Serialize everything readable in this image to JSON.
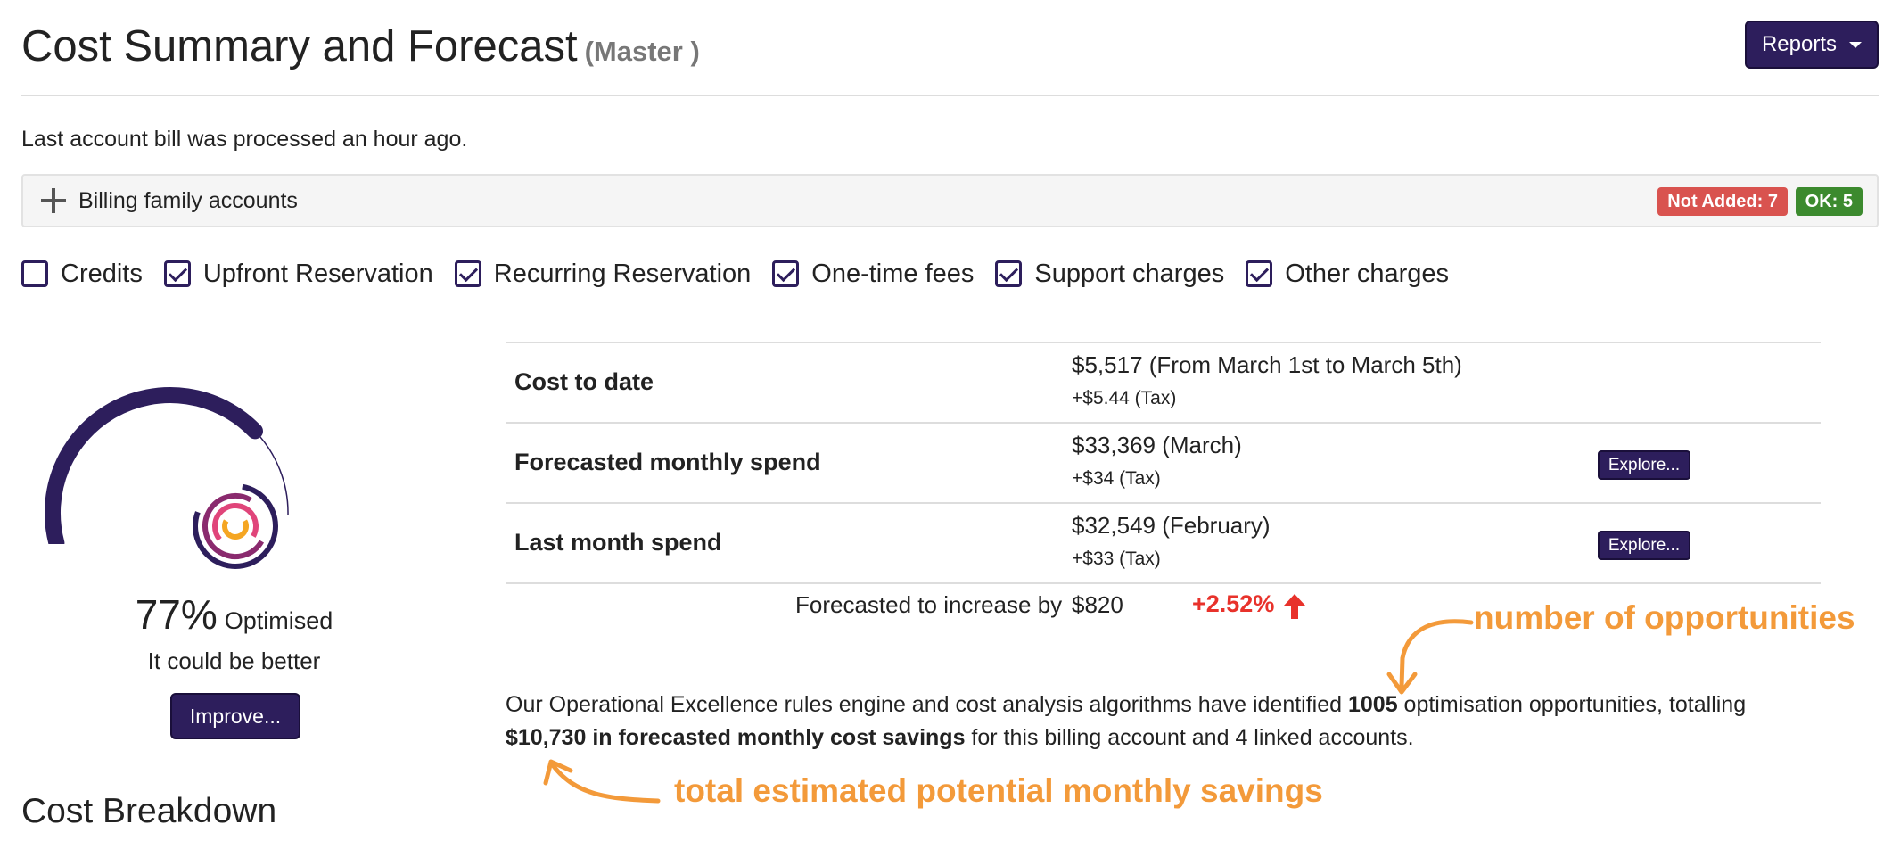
{
  "header": {
    "title": "Cost Summary and Forecast",
    "subtitle": "(Master )",
    "reports_label": "Reports"
  },
  "status": {
    "last_bill": "Last account bill was processed an hour ago."
  },
  "billing_family": {
    "label": "Billing family accounts",
    "not_added": "Not Added: 7",
    "ok": "OK: 5"
  },
  "filters": [
    {
      "label": "Credits",
      "checked": false
    },
    {
      "label": "Upfront Reservation",
      "checked": true
    },
    {
      "label": "Recurring Reservation",
      "checked": true
    },
    {
      "label": "One-time fees",
      "checked": true
    },
    {
      "label": "Support charges",
      "checked": true
    },
    {
      "label": "Other charges",
      "checked": true
    }
  ],
  "gauge": {
    "percent": 77,
    "percent_text": "77%",
    "word": "Optimised",
    "message": "It could be better",
    "improve_label": "Improve...",
    "color": "#2d1e5c"
  },
  "cost_table": {
    "rows": [
      {
        "label": "Cost to date",
        "value": "$5,517 (From March 1st to March 5th)",
        "tax": "+$5.44 (Tax)",
        "explore": null
      },
      {
        "label": "Forecasted monthly spend",
        "value": "$33,369 (March)",
        "tax": "+$34 (Tax)",
        "explore": "Explore..."
      },
      {
        "label": "Last month spend",
        "value": "$32,549 (February)",
        "tax": "+$33 (Tax)",
        "explore": "Explore..."
      }
    ],
    "increase_label": "Forecasted to increase by",
    "increase_amount": "$820",
    "increase_percent": "+2.52%"
  },
  "summary": {
    "part1": "Our Operational Excellence rules engine and cost analysis algorithms have identified ",
    "count": "1005",
    "part2": " optimisation opportunities, totalling ",
    "savings": "$10,730 in forecasted monthly cost savings",
    "part3": " for this billing account and 4 linked accounts."
  },
  "annotations": {
    "opportunities": "number of opportunities",
    "savings": "total estimated potential monthly savings",
    "color": "#f39a3a"
  },
  "section": {
    "breakdown_title": "Cost Breakdown"
  }
}
